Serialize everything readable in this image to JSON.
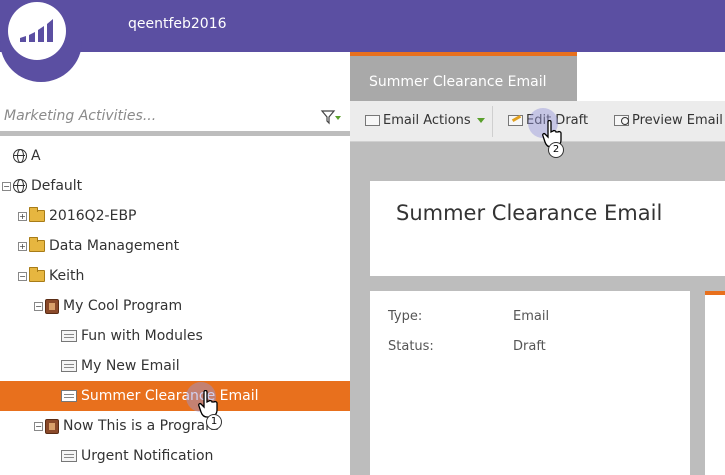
{
  "header": {
    "workspace": "qeentfeb2016"
  },
  "left_panel": {
    "search_placeholder": "Marketing Activities...",
    "tree": [
      {
        "label": "A",
        "icon": "globe-icon",
        "expander": "",
        "level": 0
      },
      {
        "label": "Default",
        "icon": "globe-icon",
        "expander": "−",
        "level": 0
      },
      {
        "label": "2016Q2-EBP",
        "icon": "folder-icon",
        "expander": "+",
        "level": 1
      },
      {
        "label": "Data Management",
        "icon": "folder-icon",
        "expander": "+",
        "level": 1
      },
      {
        "label": "Keith",
        "icon": "folder-icon",
        "expander": "−",
        "level": 1
      },
      {
        "label": "My Cool Program",
        "icon": "program-icon",
        "expander": "−",
        "level": 2
      },
      {
        "label": "Fun with Modules",
        "icon": "email-icon",
        "expander": "",
        "level": 3
      },
      {
        "label": "My New Email",
        "icon": "email-icon",
        "expander": "",
        "level": 3
      },
      {
        "label": "Summer Clearance Email",
        "icon": "email-icon",
        "expander": "",
        "level": 3,
        "selected": true
      },
      {
        "label": "Now This is a Program",
        "icon": "program-icon",
        "expander": "−",
        "level": 2
      },
      {
        "label": "Urgent Notification",
        "icon": "email-icon",
        "expander": "",
        "level": 3
      }
    ]
  },
  "right_panel": {
    "tab_label": "Summer Clearance Email",
    "toolbar": {
      "email_actions": "Email Actions",
      "edit_draft": "Edit Draft",
      "preview_email": "Preview Email"
    },
    "title": "Summer Clearance Email",
    "info": {
      "type_label": "Type:",
      "type_value": "Email",
      "status_label": "Status:",
      "status_value": "Draft"
    }
  },
  "cursors": [
    {
      "badge": "1"
    },
    {
      "badge": "2"
    }
  ],
  "colors": {
    "header": "#5b4fa2",
    "accent": "#e8701d",
    "selected_row": "#e8701d"
  }
}
